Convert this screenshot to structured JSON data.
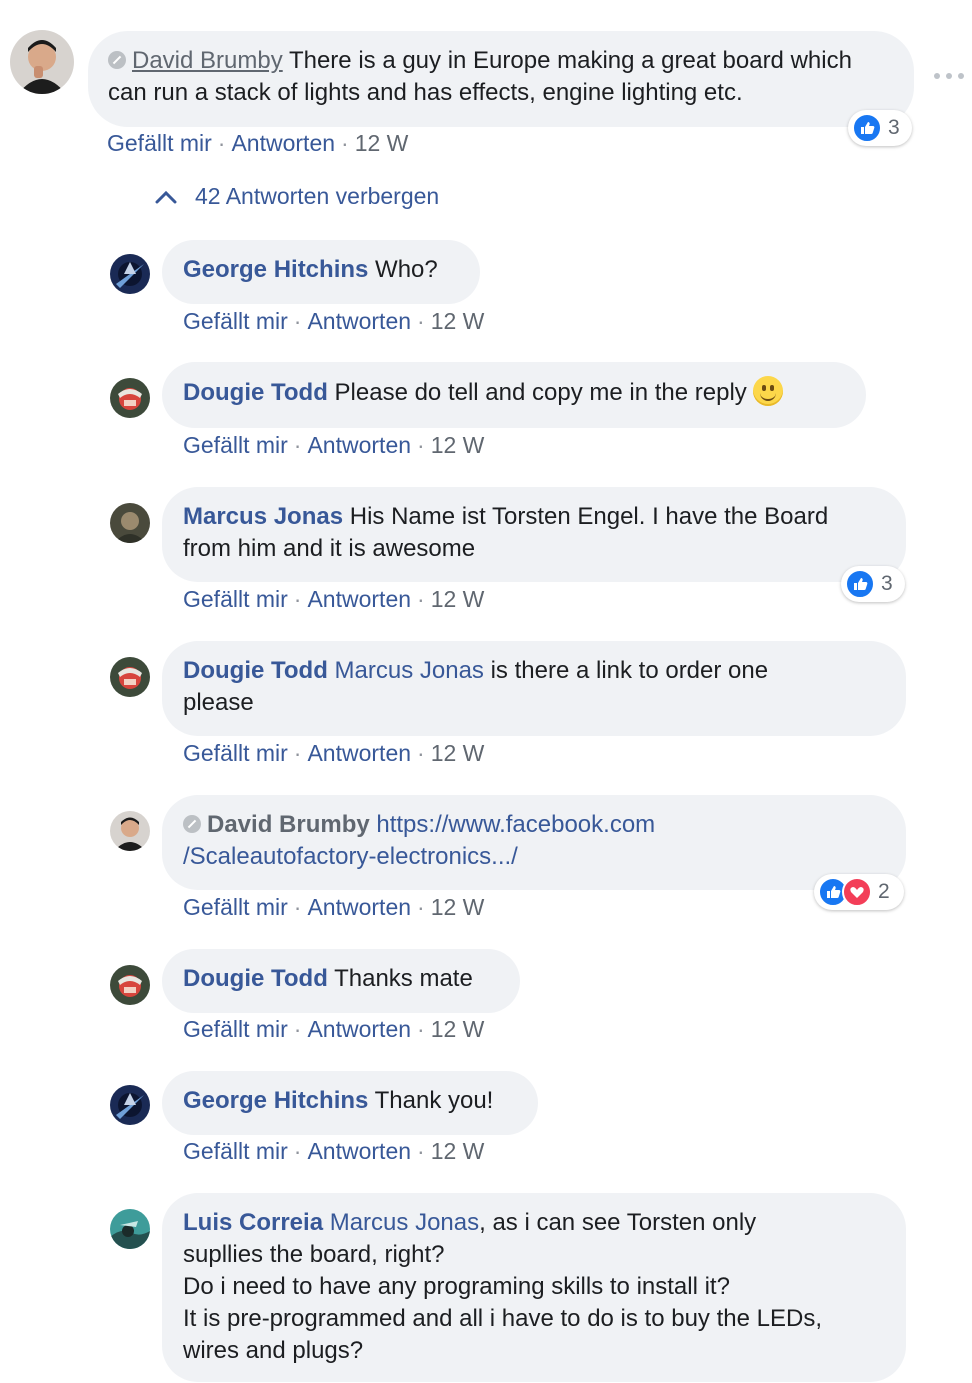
{
  "root_comment": {
    "author": "David Brumby",
    "text": "There is a guy in Europe making a great board which can run a stack of lights and has effects, engine lighting etc.",
    "reaction_count": "3",
    "like": "Gefällt mir",
    "reply": "Antworten",
    "time": "12 W"
  },
  "hide_replies_label": "42 Antworten verbergen",
  "replies": [
    {
      "author": "George Hitchins",
      "text": "Who?",
      "like": "Gefällt mir",
      "reply": "Antworten",
      "time": "12 W"
    },
    {
      "author": "Dougie Todd",
      "text": "Please do tell and copy me in the reply",
      "like": "Gefällt mir",
      "reply": "Antworten",
      "time": "12 W"
    },
    {
      "author": "Marcus Jonas",
      "text": "His Name ist Torsten Engel. I have the Board\nfrom him and it is awesome",
      "reaction_count": "3",
      "like": "Gefällt mir",
      "reply": "Antworten",
      "time": "12 W"
    },
    {
      "author": "Dougie Todd",
      "mention": "Marcus Jonas",
      "text": "is there a link to order one\nplease",
      "like": "Gefällt mir",
      "reply": "Antworten",
      "time": "12 W"
    },
    {
      "author": "David Brumby",
      "link": "https://www.facebook.com\n/Scaleautofactory-electronics.../",
      "reaction_count": "2",
      "like": "Gefällt mir",
      "reply": "Antworten",
      "time": "12 W"
    },
    {
      "author": "Dougie Todd",
      "text": "Thanks mate",
      "like": "Gefällt mir",
      "reply": "Antworten",
      "time": "12 W"
    },
    {
      "author": "George Hitchins",
      "text": "Thank you!",
      "like": "Gefällt mir",
      "reply": "Antworten",
      "time": "12 W"
    },
    {
      "author": "Luis Correia",
      "mention": "Marcus Jonas",
      "text": ", as i can see Torsten only\nsupllies the board, right?\nDo i need to have any programing skills to install it?\nIt is pre-programmed and all i have to do is to buy the LEDs,\nwires and plugs?"
    }
  ],
  "colors": {
    "link_blue": "#385898",
    "bubble_bg": "#f0f2f5",
    "like_blue": "#1877f2",
    "love_red": "#f33e58"
  },
  "icons": [
    "more-options-icon",
    "chevron-up-icon",
    "like-reaction-icon",
    "love-reaction-icon",
    "smile-emoji-icon",
    "verified-badge-icon"
  ]
}
